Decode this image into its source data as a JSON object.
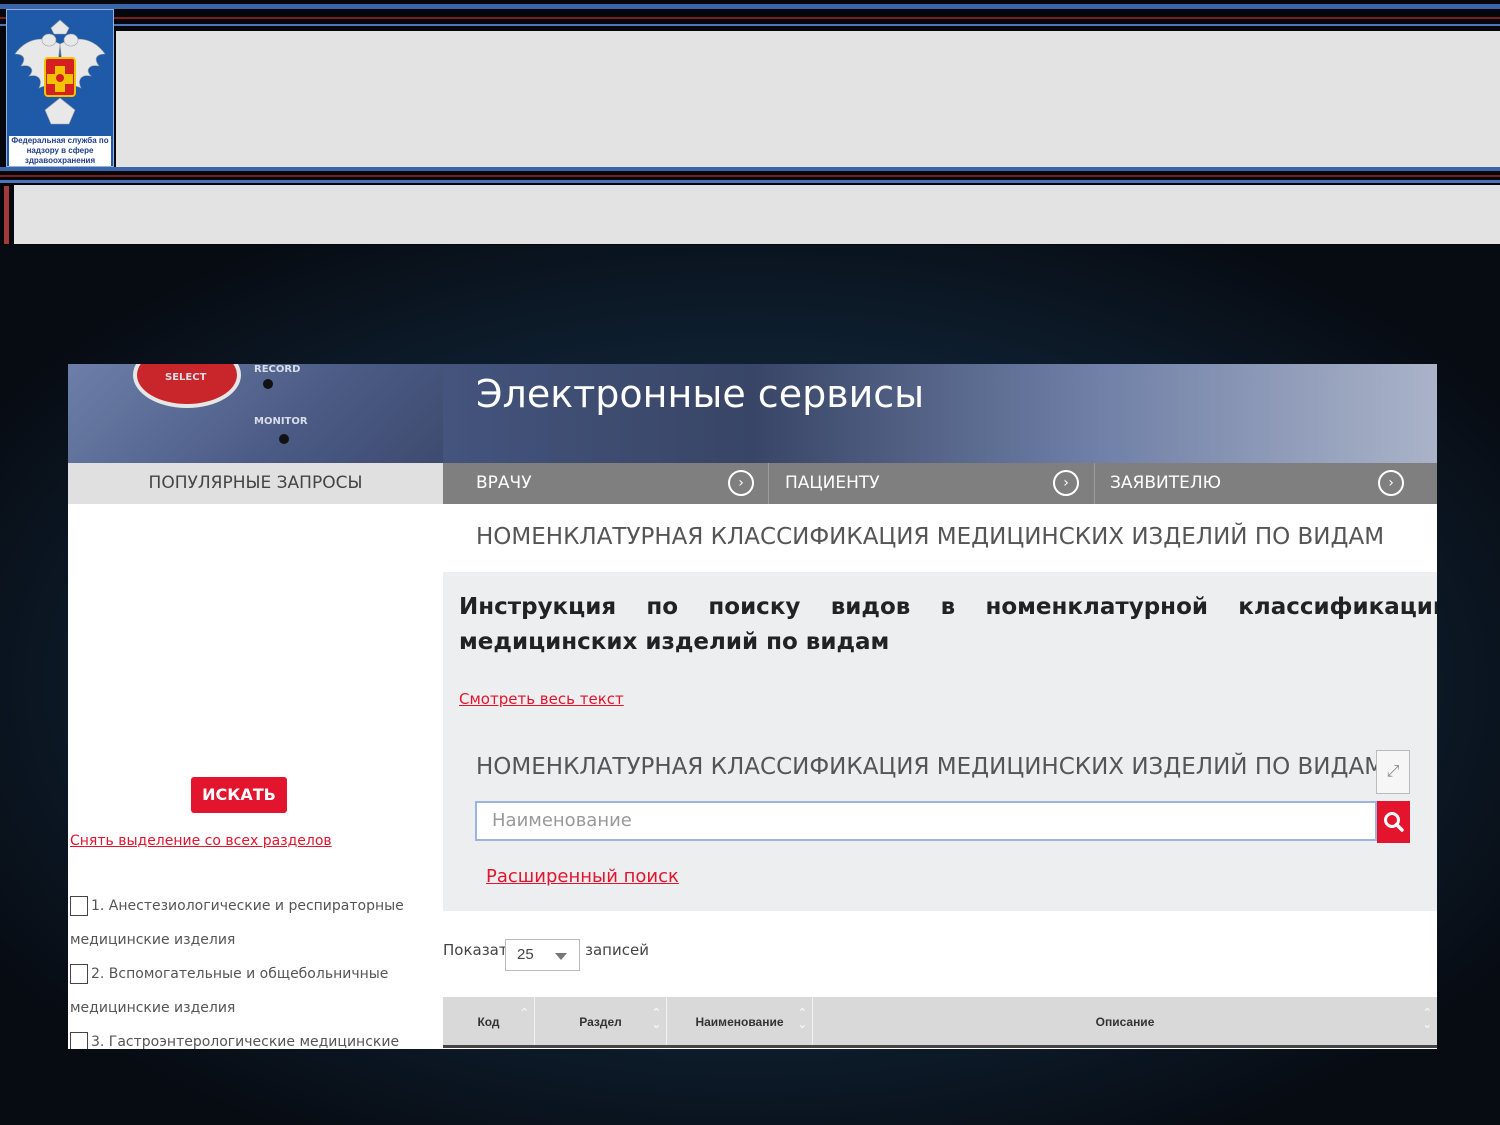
{
  "logo": {
    "caption": "Федеральная служба по надзору в сфере здравоохранения"
  },
  "banner": {
    "title": "Электронные сервисы",
    "device_labels": [
      "SELECT",
      "MONITOR",
      "RECORD"
    ]
  },
  "nav": {
    "popular": "ПОПУЛЯРНЫЕ ЗАПРОСЫ",
    "tabs": [
      {
        "label": "ВРАЧУ"
      },
      {
        "label": "ПАЦИЕНТУ"
      },
      {
        "label": "ЗАЯВИТЕЛЮ"
      }
    ]
  },
  "sidebar": {
    "search_button": "ИСКАТЬ",
    "unselect_link": "Снять выделение со всех разделов",
    "categories": [
      {
        "line1": "1. Анестезиологические и респираторные",
        "line2": "медицинские изделия"
      },
      {
        "line1": "2. Вспомогательные и общебольничные",
        "line2": "медицинские изделия"
      },
      {
        "line1": "3. Гастроэнтерологические медицинские"
      }
    ]
  },
  "main": {
    "heading": "НОМЕНКЛАТУРНАЯ КЛАССИФИКАЦИЯ МЕДИЦИНСКИХ ИЗДЕЛИЙ ПО ВИДАМ",
    "instruction": "Инструкция по поиску видов в номенклатурной классификации медицинских изделий по видам",
    "full_text_link": "Смотреть весь текст",
    "sub_heading": "НОМЕНКЛАТУРНАЯ КЛАССИФИКАЦИЯ МЕДИЦИНСКИХ ИЗДЕЛИЙ ПО ВИДАМ",
    "search_placeholder": "Наименование",
    "advanced_search": "Расширенный поиск",
    "show_label": "Показать",
    "page_size": "25",
    "records_label": "записей",
    "columns": [
      "Код",
      "Раздел",
      "Наименование",
      "Описание"
    ]
  },
  "colors": {
    "accent_red": "#e3142d",
    "nav_gray": "#7f7f7f",
    "slide_blue": "#3a65a8"
  }
}
